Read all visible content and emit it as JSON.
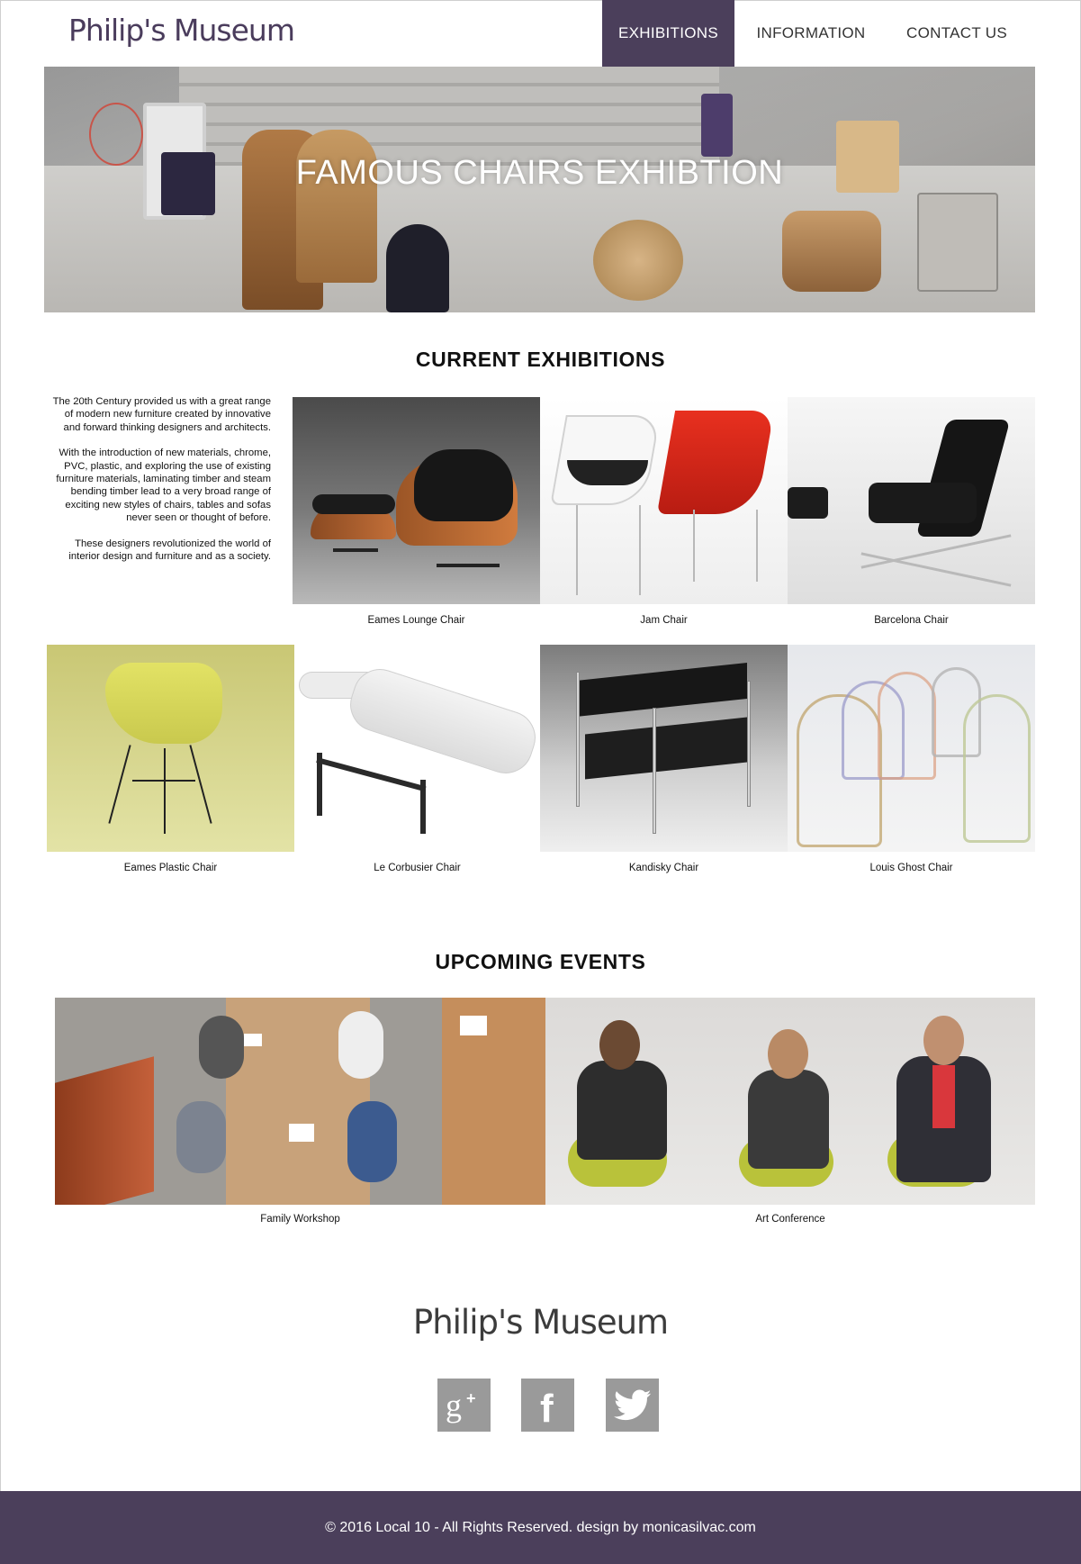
{
  "header": {
    "logo": "Philip's Museum",
    "nav": [
      {
        "label": "EXHIBITIONS",
        "active": true
      },
      {
        "label": "INFORMATION",
        "active": false
      },
      {
        "label": "CONTACT US",
        "active": false
      }
    ]
  },
  "hero": {
    "title": "FAMOUS CHAIRS EXHIBTION"
  },
  "current": {
    "title": "CURRENT EXHIBITIONS",
    "intro": [
      "The 20th Century provided us with a great range of modern new furniture created by innovative and forward thinking designers and architects.",
      "With the introduction of new materials, chrome, PVC, plastic, and exploring the use of existing furniture materials, laminating timber and steam bending timber lead to a very broad range of exciting new styles of chairs, tables and sofas never seen or thought of before.",
      "These designers revolutionized the world of interior design and furniture and as a society."
    ],
    "chairs": [
      {
        "name": "Eames Lounge Chair"
      },
      {
        "name": "Jam Chair"
      },
      {
        "name": "Barcelona Chair"
      },
      {
        "name": "Eames Plastic Chair"
      },
      {
        "name": "Le Corbusier Chair"
      },
      {
        "name": "Kandisky Chair"
      },
      {
        "name": "Louis Ghost Chair"
      }
    ]
  },
  "events": {
    "title": "UPCOMING EVENTS",
    "items": [
      {
        "name": "Family Workshop"
      },
      {
        "name": "Art Conference"
      }
    ]
  },
  "footer": {
    "logo": "Philip's Museum",
    "social": [
      {
        "icon": "google-plus-icon",
        "glyph": "g+"
      },
      {
        "icon": "facebook-icon",
        "glyph": "f"
      },
      {
        "icon": "twitter-icon",
        "glyph": ""
      }
    ],
    "copyright": "© 2016 Local 10 - All Rights Reserved. design by monicasilvac.com"
  },
  "colors": {
    "brand_purple": "#4b3f5b",
    "icon_gray": "#9a9a9a"
  }
}
